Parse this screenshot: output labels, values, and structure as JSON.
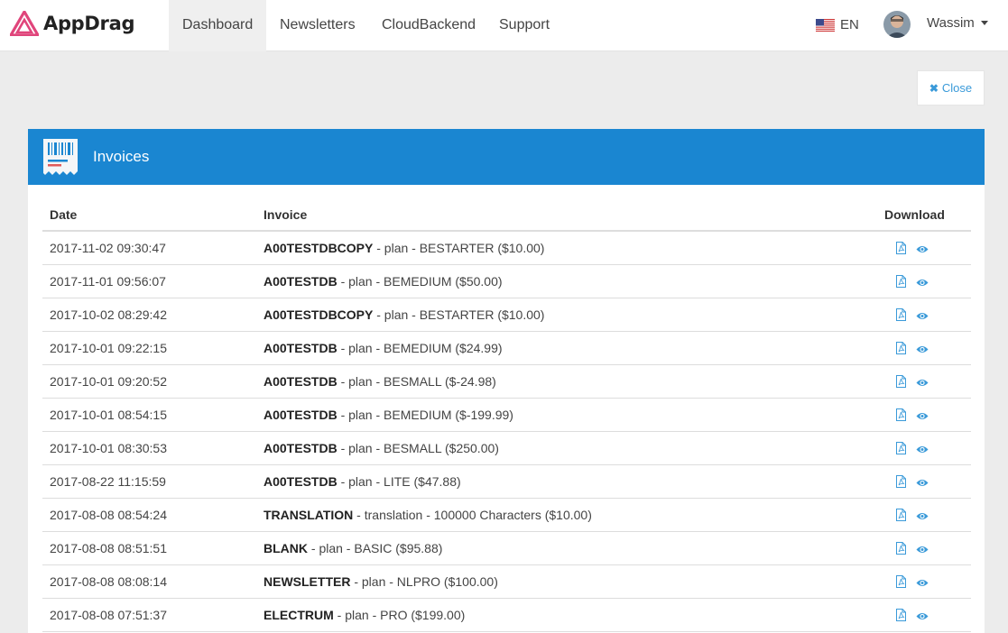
{
  "brand": {
    "name": "AppDrag",
    "accent": "#e0457b"
  },
  "nav": {
    "items": [
      {
        "label": "Dashboard",
        "active": true
      },
      {
        "label": "Newsletters",
        "active": false
      },
      {
        "label": "CloudBackend",
        "active": false
      },
      {
        "label": "Support",
        "active": false
      }
    ],
    "language": "EN",
    "user": "Wassim"
  },
  "close_label": "Close",
  "panel": {
    "title": "Invoices",
    "header_color": "#1a86d1",
    "icon": "receipt-icon"
  },
  "table": {
    "headers": {
      "date": "Date",
      "invoice": "Invoice",
      "download": "Download"
    },
    "rows": [
      {
        "date": "2017-11-02 09:30:47",
        "name": "A00TESTDBCOPY",
        "detail": " - plan - BESTARTER ($10.00)"
      },
      {
        "date": "2017-11-01 09:56:07",
        "name": "A00TESTDB",
        "detail": " - plan - BEMEDIUM ($50.00)"
      },
      {
        "date": "2017-10-02 08:29:42",
        "name": "A00TESTDBCOPY",
        "detail": " - plan - BESTARTER ($10.00)"
      },
      {
        "date": "2017-10-01 09:22:15",
        "name": "A00TESTDB",
        "detail": " - plan - BEMEDIUM ($24.99)"
      },
      {
        "date": "2017-10-01 09:20:52",
        "name": "A00TESTDB",
        "detail": " - plan - BESMALL ($-24.98)"
      },
      {
        "date": "2017-10-01 08:54:15",
        "name": "A00TESTDB",
        "detail": " - plan - BEMEDIUM ($-199.99)"
      },
      {
        "date": "2017-10-01 08:30:53",
        "name": "A00TESTDB",
        "detail": " - plan - BESMALL ($250.00)"
      },
      {
        "date": "2017-08-22 11:15:59",
        "name": "A00TESTDB",
        "detail": " - plan - LITE ($47.88)"
      },
      {
        "date": "2017-08-08 08:54:24",
        "name": "TRANSLATION",
        "detail": " - translation - 100000 Characters ($10.00)"
      },
      {
        "date": "2017-08-08 08:51:51",
        "name": "BLANK",
        "detail": " - plan - BASIC ($95.88)"
      },
      {
        "date": "2017-08-08 08:08:14",
        "name": "NEWSLETTER",
        "detail": " - plan - NLPRO ($100.00)"
      },
      {
        "date": "2017-08-08 07:51:37",
        "name": "ELECTRUM",
        "detail": " - plan - PRO ($199.00)"
      }
    ]
  },
  "icon_color": "#3a9ad9"
}
